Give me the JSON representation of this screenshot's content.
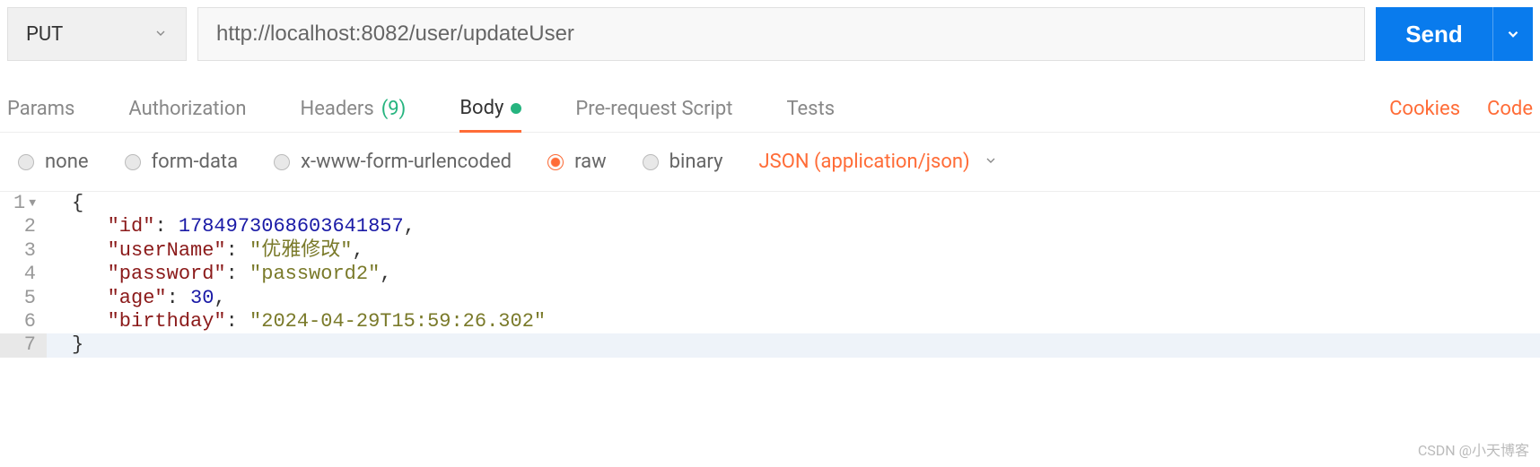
{
  "request": {
    "method": "PUT",
    "url": "http://localhost:8082/user/updateUser",
    "send_label": "Send"
  },
  "tabs": {
    "params": "Params",
    "authorization": "Authorization",
    "headers": "Headers",
    "headers_count": "(9)",
    "body": "Body",
    "prerequest": "Pre-request Script",
    "tests": "Tests"
  },
  "links": {
    "cookies": "Cookies",
    "code": "Code"
  },
  "body_options": {
    "none": "none",
    "formdata": "form-data",
    "urlencoded": "x-www-form-urlencoded",
    "raw": "raw",
    "binary": "binary",
    "content_type": "JSON (application/json)"
  },
  "editor": {
    "lines": [
      "1",
      "2",
      "3",
      "4",
      "5",
      "6",
      "7"
    ],
    "body": {
      "id_key": "\"id\"",
      "id_val": "1784973068603641857",
      "userName_key": "\"userName\"",
      "userName_val": "\"优雅修改\"",
      "password_key": "\"password\"",
      "password_val": "\"password2\"",
      "age_key": "\"age\"",
      "age_val": "30",
      "birthday_key": "\"birthday\"",
      "birthday_val": "\"2024-04-29T15:59:26.302\""
    }
  },
  "watermark": "CSDN @小天博客"
}
